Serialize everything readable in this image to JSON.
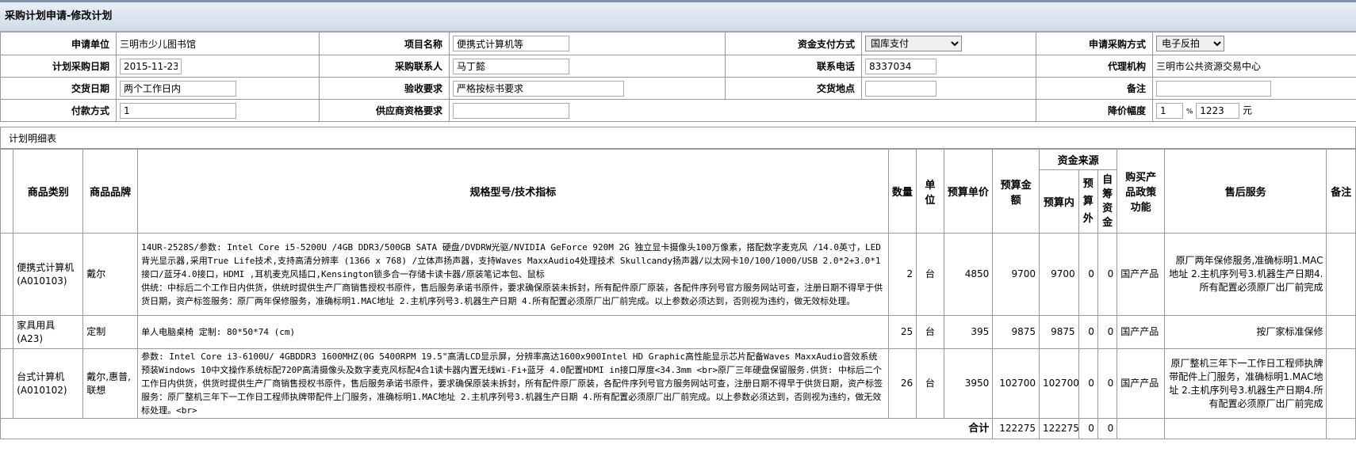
{
  "title": "采购计划申请-修改计划",
  "form": {
    "applicant_unit_label": "申请单位",
    "applicant_unit_value": "三明市少儿图书馆",
    "project_name_label": "项目名称",
    "project_name_value": "便携式计算机等",
    "fund_pay_label": "资金支付方式",
    "fund_pay_value": "国库支付",
    "proc_method_label": "申请采购方式",
    "proc_method_value": "电子反拍",
    "plan_date_label": "计划采购日期",
    "plan_date_value": "2015-11-23",
    "contact_label": "采购联系人",
    "contact_value": "马丁懿",
    "phone_label": "联系电话",
    "phone_value": "8337034",
    "agency_label": "代理机构",
    "agency_value": "三明市公共资源交易中心",
    "delivery_date_label": "交货日期",
    "delivery_date_value": "两个工作日内",
    "acceptance_label": "验收要求",
    "acceptance_value": "严格按标书要求",
    "delivery_place_label": "交货地点",
    "delivery_place_value": "",
    "remark_label": "备注",
    "remark_value": "",
    "payment_label": "付款方式",
    "payment_value": "1",
    "supplier_req_label": "供应商资格要求",
    "supplier_req_value": "",
    "discount_label": "降价幅度",
    "discount_pct_value": "1",
    "discount_pct_unit": "%",
    "discount_amt_value": "1223",
    "discount_amt_unit": "元"
  },
  "detail": {
    "section_label": "计划明细表",
    "headers": {
      "category": "商品类别",
      "brand": "商品品牌",
      "spec": "规格型号/技术指标",
      "qty": "数量",
      "unit": "单位",
      "unit_price": "预算单价",
      "amount": "预算金额",
      "fund_source": "资金来源",
      "in_budget": "预算内",
      "out_budget": "预算外",
      "self_raised": "自筹资金",
      "policy": "购买产品政策功能",
      "after_sales": "售后服务",
      "remark": "备注"
    },
    "rows": [
      {
        "category": "便携式计算机",
        "code": "(A010103)",
        "brand": "戴尔",
        "spec": "14UR-2528S/参数: Intel Core i5-5200U /4GB DDR3/500GB SATA 硬盘/DVDRW光驱/NVIDIA GeForce 920M 2G 独立显卡摄像头100万像素，搭配数字麦克风 /14.0英寸，LED背光显示器,采用True Life技术,支持高清分辨率 (1366 x 768) /立体声扬声器，支持Waves MaxxAudio4处理技术 Skullcandy扬声器/以太网卡10/100/1000/USB 2.0*2+3.0*1接口/蓝牙4.0接口，HDMI ,耳机麦克风插口,Kensington锁多合一存储卡读卡器/原装笔记本包、鼠标\n供统：中标后二个工作日内供货，供统时提供生产厂商销售授权书原件，售后服务承诺书原件，要求确保原装未拆封，所有配件原厂原装，各配件序列号官方服务网站可查，注册日期不得早于供货日期，资产标签服务：原厂两年保修服务，准确标明1.MAC地址 2.主机序列号3.机器生产日期 4.所有配置必须原厂出厂前完成。以上参数必须达到，否则视为违约，做无效标处理。",
        "qty": "2",
        "unit": "台",
        "unit_price": "4850",
        "amount": "9700",
        "in_budget": "9700",
        "out_budget": "0",
        "self_raised": "0",
        "policy": "国产产品",
        "after_sales": "原厂两年保修服务,准确标明1.MAC地址 2.主机序列号3.机器生产日期4.所有配置必须原厂出厂前完成",
        "remark": ""
      },
      {
        "category": "家具用具",
        "code": "(A23)",
        "brand": "定制",
        "spec": "单人电脑桌椅 定制: 80*50*74 (cm)",
        "qty": "25",
        "unit": "台",
        "unit_price": "395",
        "amount": "9875",
        "in_budget": "9875",
        "out_budget": "0",
        "self_raised": "0",
        "policy": "国产产品",
        "after_sales": "按厂家标准保修",
        "remark": ""
      },
      {
        "category": "台式计算机",
        "code": "(A010102)",
        "brand": "戴尔,惠普,联想",
        "spec": "参数: Intel Core i3-6100U/ 4GBDDR3 1600MHZ(0G 5400RPM 19.5\"高清LCD显示屏，分辨率高达1600x900Intel HD Graphic高性能显示芯片配备Waves MaxxAudio音效系统预装Windows 10中文操作系统标配720P高清摄像头及数字麦克风标配4合1读卡器内置无线Wi-Fi+蓝牙 4.0配置HDMI in接口厚度<34.3mm <br>原厂三年硬盘保留服务.供货: 中标后二个工作日内供货，供货时提供生产厂商销售授权书原件，售后服务承诺书原件，要求确保原装未拆封，所有配件原厂原装，各配件序列号官方服务网站可查，注册日期不得早于供货日期，资产标签服务：原厂整机三年下一工作日工程师执牌带配件上门服务，准确标明1.MAC地址 2.主机序列号3.机器生产日期 4.所有配置必须原厂出厂前完成。以上参数必须达到，否则视为违约，做无效标处理。<br>",
        "qty": "26",
        "unit": "台",
        "unit_price": "3950",
        "amount": "102700",
        "in_budget": "102700",
        "out_budget": "0",
        "self_raised": "0",
        "policy": "国产产品",
        "after_sales": "原厂整机三年下一工作日工程师执牌带配件上门服务，准确标明1.MAC地址 2.主机序列号3.机器生产日期4.所有配置必须原厂出厂前完成",
        "remark": ""
      }
    ],
    "total": {
      "label": "合计",
      "amount": "122275",
      "in_budget": "122275",
      "out_budget": "0",
      "self_raised": "0"
    }
  }
}
